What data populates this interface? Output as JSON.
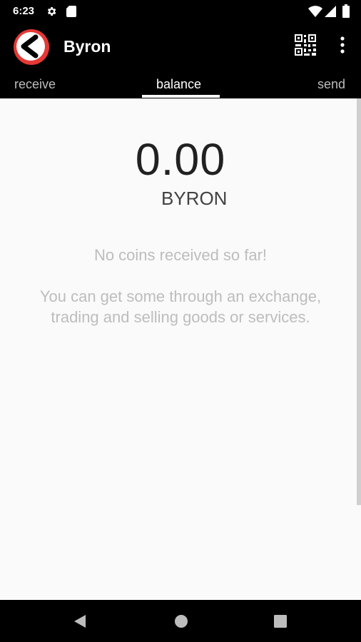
{
  "status_bar": {
    "time": "6:23"
  },
  "app_bar": {
    "title": "Byron"
  },
  "tabs": [
    {
      "label": "receive"
    },
    {
      "label": "balance"
    },
    {
      "label": "send"
    }
  ],
  "wallet": {
    "balance": "0.00",
    "currency": "BYRON"
  },
  "empty_state": {
    "title": "No coins received so far!",
    "message": "You can get some through an exchange, trading and selling goods or services."
  },
  "icons": {
    "status": [
      "settings-icon",
      "sd-card-icon",
      "wifi-icon",
      "cellular-icon",
      "battery-icon"
    ],
    "app_bar": [
      "byron-logo",
      "qr-code-icon",
      "more-vert-icon"
    ],
    "nav": [
      "back-icon",
      "home-icon",
      "recents-icon"
    ]
  },
  "colors": {
    "app_bar_bg": "#000000",
    "logo_red": "#e53935",
    "content_bg": "#fafafa",
    "muted_text": "#bdbdbd"
  }
}
